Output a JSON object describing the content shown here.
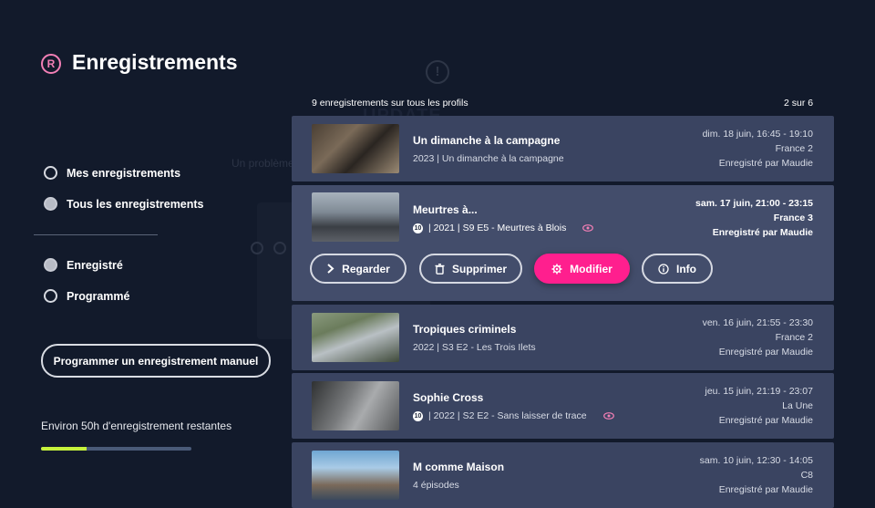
{
  "header": {
    "title": "Enregistrements",
    "logo_glyph": "R"
  },
  "background": {
    "ghost_text1": "UPDATE",
    "ghost_text2": "Un problème"
  },
  "sidebar": {
    "profile_filters": [
      {
        "label": "Mes enregistrements",
        "selected": false
      },
      {
        "label": "Tous les enregistrements",
        "selected": true
      }
    ],
    "status_filters": [
      {
        "label": "Enregistré",
        "selected": true
      },
      {
        "label": "Programmé",
        "selected": false
      }
    ],
    "manual_button": "Programmer un enregistrement manuel",
    "remaining_label": "Environ 50h d'enregistrement restantes",
    "storage_used_fraction": 0.3,
    "storage_color": "#c6f23c"
  },
  "list": {
    "count_label": "9 enregistrements sur tous les profils",
    "page_label": "2 sur 6",
    "items": [
      {
        "title": "Un dimanche à la campagne",
        "age": "",
        "meta": "2023  |  Un dimanche à la campagne",
        "watched": false,
        "datetime": "dim. 18 juin, 16:45 - 19:10",
        "channel": "France 2",
        "recorded_by": "Enregistré par Maudie"
      },
      {
        "title": "Meurtres à...",
        "age": "10",
        "meta": "|  2021  |  S9 E5 - Meurtres à Blois",
        "watched": true,
        "datetime": "sam. 17 juin, 21:00 - 23:15",
        "channel": "France 3",
        "recorded_by": "Enregistré par Maudie"
      },
      {
        "title": "Tropiques criminels",
        "age": "",
        "meta": "2022  |  S3 E2 - Les Trois Ilets",
        "watched": false,
        "datetime": "ven. 16 juin, 21:55 - 23:30",
        "channel": "France 2",
        "recorded_by": "Enregistré par Maudie"
      },
      {
        "title": "Sophie Cross",
        "age": "10",
        "meta": "|  2022  |  S2 E2 - Sans laisser de trace",
        "watched": true,
        "datetime": "jeu. 15 juin, 21:19 - 23:07",
        "channel": "La Une",
        "recorded_by": "Enregistré par Maudie"
      },
      {
        "title": "M comme Maison",
        "age": "",
        "meta": "4 épisodes",
        "watched": false,
        "datetime": "sam. 10 juin, 12:30 - 14:05",
        "channel": "C8",
        "recorded_by": "Enregistré par Maudie"
      }
    ],
    "actions": {
      "watch": "Regarder",
      "delete": "Supprimer",
      "edit": "Modifier",
      "info": "Info"
    }
  },
  "colors": {
    "accent": "#ff1f8e",
    "logo": "#f27fb5",
    "card": "#3a4461",
    "background": "#121a2b"
  },
  "icons": [
    "registered-icon",
    "alert-icon",
    "play-chevron-icon",
    "trash-icon",
    "gear-icon",
    "info-icon",
    "eye-icon"
  ]
}
